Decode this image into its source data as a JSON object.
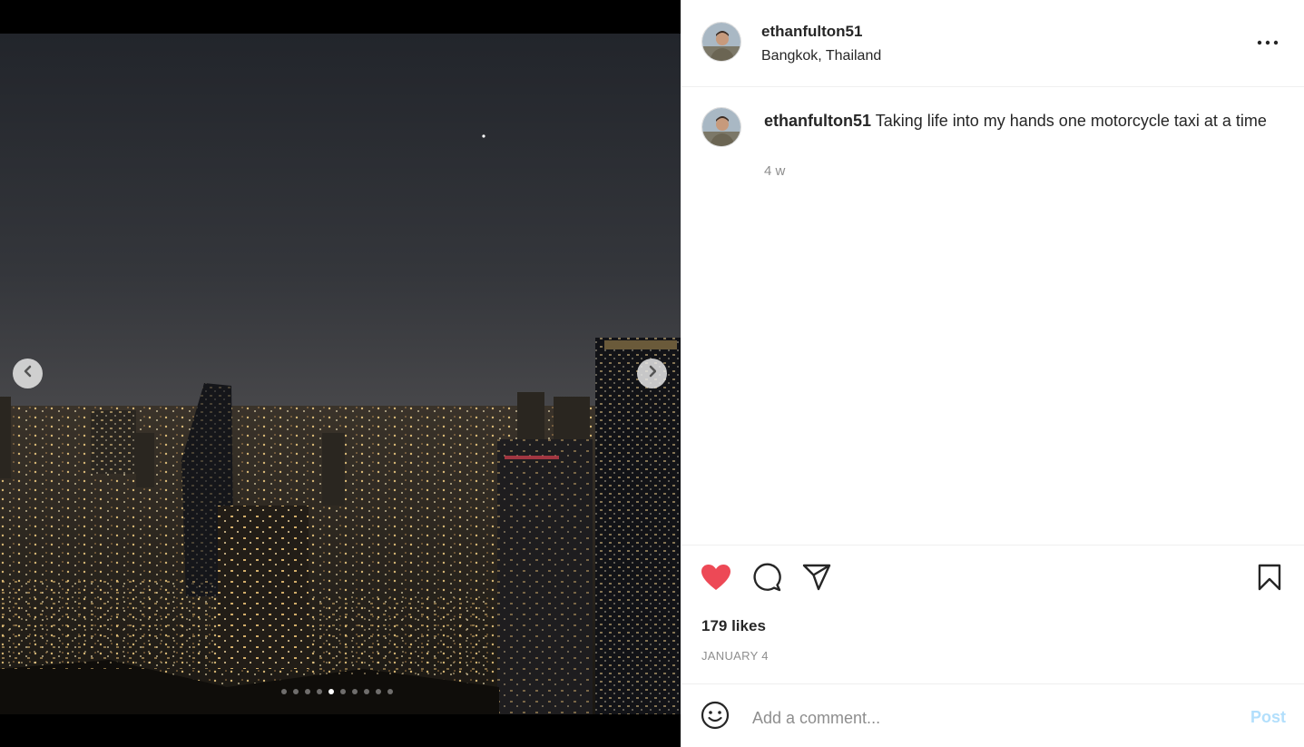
{
  "post": {
    "username": "ethanfulton51",
    "location": "Bangkok, Thailand",
    "caption": "Taking life into my hands one motorcycle taxi at a time",
    "caption_time": "4 w",
    "likes": "179 likes",
    "date": "JANUARY 4",
    "liked": true
  },
  "carousel": {
    "total_slides": 10,
    "active_index": 4
  },
  "comment": {
    "placeholder": "Add a comment...",
    "post_label": "Post"
  },
  "icons": {
    "more": "more-options-icon",
    "like": "heart-filled-icon",
    "comment": "comment-bubble-icon",
    "share": "paper-plane-icon",
    "save": "bookmark-icon",
    "emoji": "smiley-icon",
    "prev": "chevron-left-icon",
    "next": "chevron-right-icon"
  },
  "colors": {
    "like_red": "#ed4956",
    "post_button_disabled": "#b2dffc",
    "text_primary": "#262626",
    "text_secondary": "#8e8e8e"
  }
}
